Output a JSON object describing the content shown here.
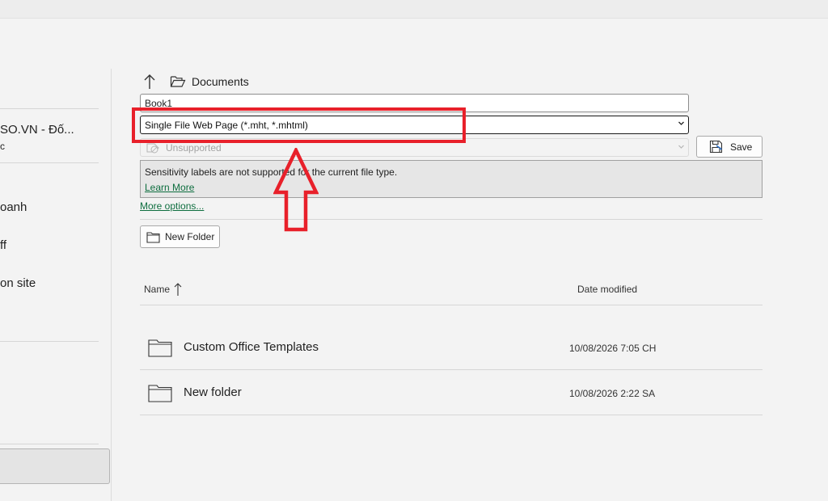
{
  "left_pane": {
    "items": [
      {
        "label": "SO.VN - Đố..."
      },
      {
        "label": "c"
      },
      {
        "label": "oanh"
      },
      {
        "label": "ff"
      },
      {
        "label": "on site"
      }
    ]
  },
  "path": {
    "location": "Documents"
  },
  "filename": {
    "value": "Book1"
  },
  "filetype": {
    "value": "Single File Web Page (*.mht, *.mhtml)"
  },
  "sensitivity": {
    "value": "Unsupported"
  },
  "save_button": {
    "label": "Save"
  },
  "info": {
    "message": "Sensitivity labels are not supported for the current file type.",
    "link": "Learn More"
  },
  "more_options": "More options...",
  "new_folder_button": {
    "label": "New Folder"
  },
  "list": {
    "columns": {
      "name": "Name",
      "date_modified": "Date modified"
    },
    "rows": [
      {
        "name": "Custom Office Templates",
        "date": "10/08/2026 7:05 CH"
      },
      {
        "name": "New folder",
        "date": "10/08/2026 2:22 SA"
      }
    ]
  },
  "colors": {
    "annotation": "#e8202a",
    "link": "#0e6e3f",
    "background": "#f3f3f3"
  },
  "icons": [
    "up-arrow-icon",
    "folder-open-icon",
    "chevron-down-icon",
    "no-sensitivity-icon",
    "save-icon",
    "folder-icon",
    "sort-up-icon"
  ]
}
